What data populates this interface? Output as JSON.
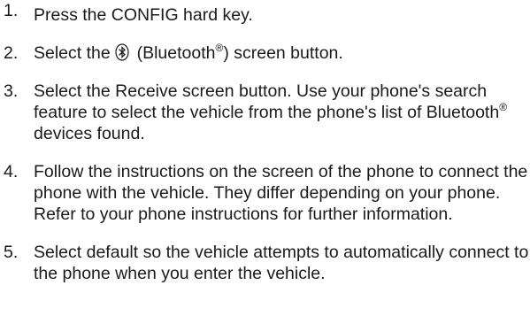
{
  "steps": [
    {
      "number": "1.",
      "text": "Press the CONFIG hard key."
    },
    {
      "number": "2.",
      "text_before": "Select the",
      "icon": "bluetooth-icon",
      "text_mid": "(Bluetooth",
      "mark": "®",
      "text_after": ") screen button."
    },
    {
      "number": "3.",
      "text_before": "Select the Receive screen button. Use your phone's search feature to select the vehicle from the phone's list of Bluetooth",
      "mark": "®",
      "text_after": " devices found."
    },
    {
      "number": "4.",
      "text": "Follow the instructions on the screen of the phone to connect the phone with the vehicle. They differ depending on your phone. Refer to your phone instructions for further information."
    },
    {
      "number": "5.",
      "text": "Select default so the vehicle attempts to automatically connect to the phone when you enter the vehicle."
    }
  ]
}
